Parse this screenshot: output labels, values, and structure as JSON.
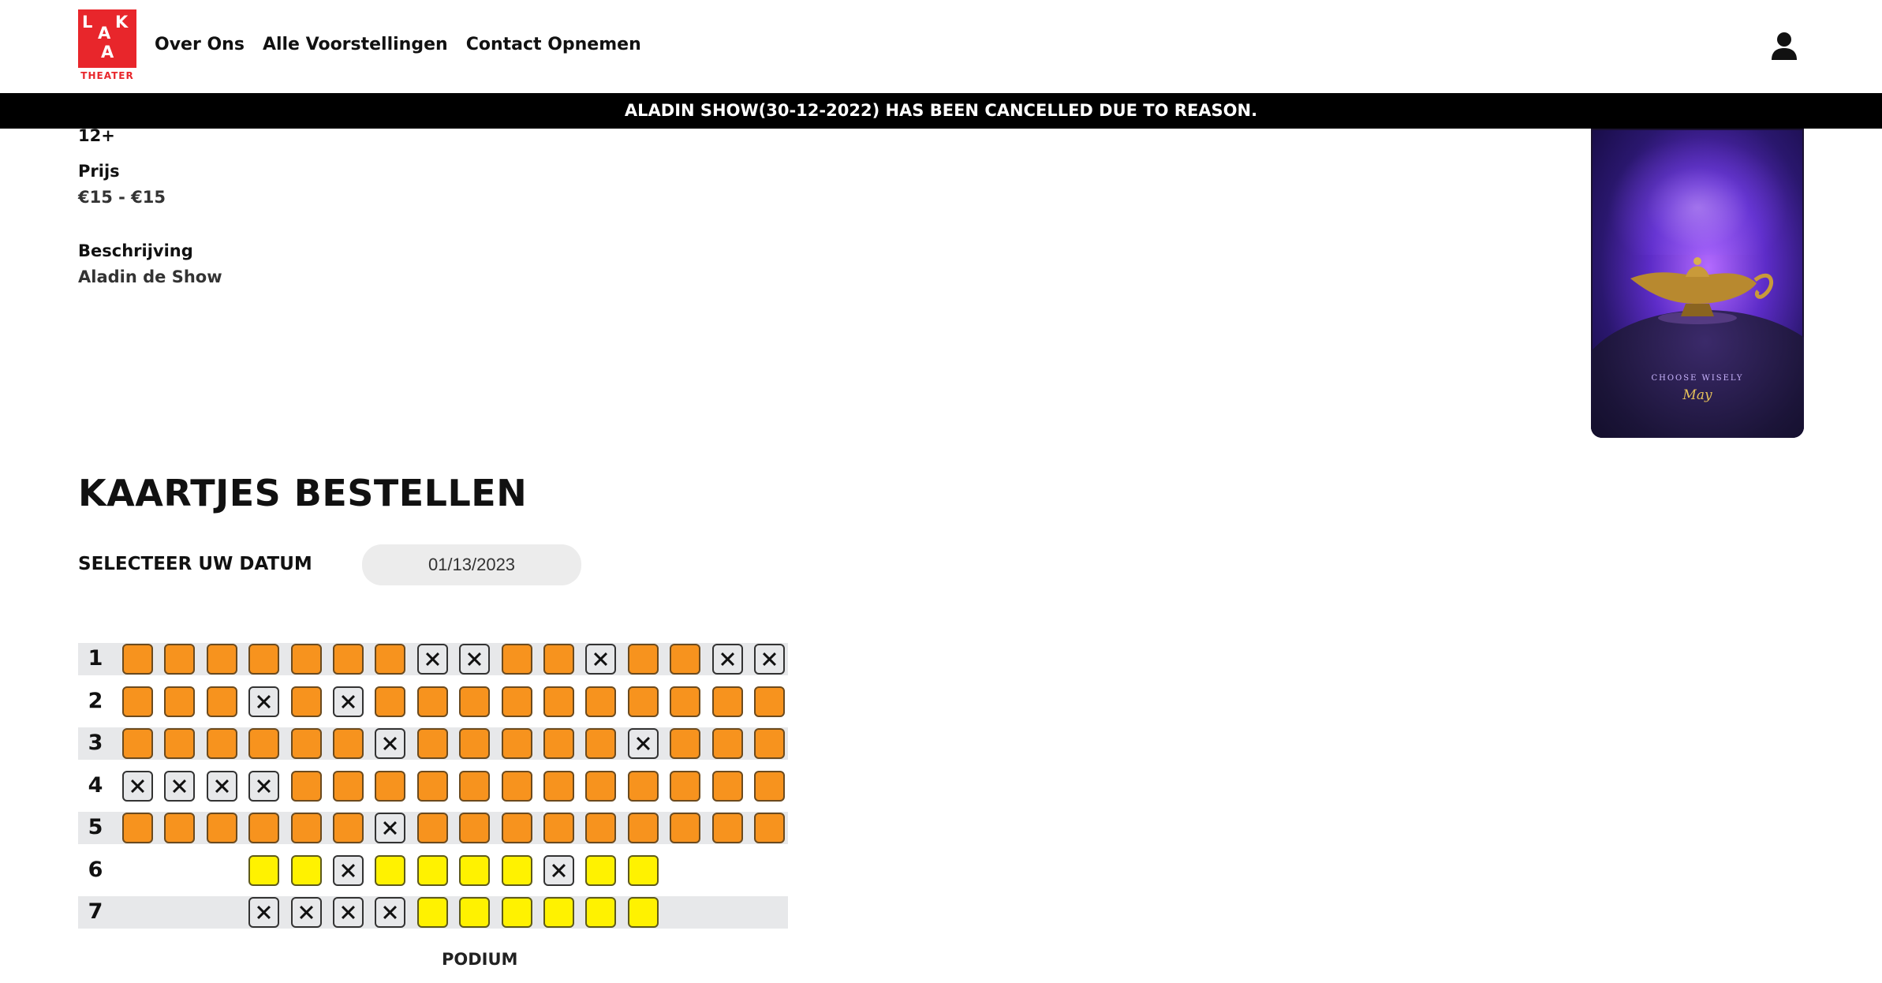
{
  "header": {
    "logo_letters": [
      "L",
      "A",
      "K",
      "A"
    ],
    "logo_sub": "THEATER",
    "nav": [
      "Over Ons",
      "Alle Voorstellingen",
      "Contact Opnemen"
    ],
    "user_icon": "user-icon"
  },
  "banner": {
    "text": "ALADIN SHOW(30-12-2022) HAS BEEN CANCELLED DUE TO REASON."
  },
  "details": {
    "age": "12+",
    "price_label": "Prijs",
    "price_value": "€15 - €15",
    "description_label": "Beschrijving",
    "description_value": "Aladin de Show"
  },
  "poster": {
    "tagline": "CHOOSE WISELY",
    "signature": "May"
  },
  "order": {
    "title": "KAARTJES BESTELLEN",
    "date_label": "SELECTEER UW DATUM",
    "date_value": "01/13/2023"
  },
  "seatmap": {
    "rows": [
      {
        "num": "1",
        "start": 0,
        "seats": [
          "o",
          "o",
          "o",
          "o",
          "o",
          "o",
          "o",
          "x",
          "x",
          "o",
          "o",
          "x",
          "o",
          "o",
          "x",
          "x"
        ]
      },
      {
        "num": "2",
        "start": 0,
        "seats": [
          "o",
          "o",
          "o",
          "x",
          "o",
          "x",
          "o",
          "o",
          "o",
          "o",
          "o",
          "o",
          "o",
          "o",
          "o",
          "o"
        ]
      },
      {
        "num": "3",
        "start": 0,
        "seats": [
          "o",
          "o",
          "o",
          "o",
          "o",
          "o",
          "x",
          "o",
          "o",
          "o",
          "o",
          "o",
          "x",
          "o",
          "o",
          "o"
        ]
      },
      {
        "num": "4",
        "start": 0,
        "seats": [
          "x",
          "x",
          "x",
          "x",
          "o",
          "o",
          "o",
          "o",
          "o",
          "o",
          "o",
          "o",
          "o",
          "o",
          "o",
          "o"
        ]
      },
      {
        "num": "5",
        "start": 0,
        "seats": [
          "o",
          "o",
          "o",
          "o",
          "o",
          "o",
          "x",
          "o",
          "o",
          "o",
          "o",
          "o",
          "o",
          "o",
          "o",
          "o"
        ]
      },
      {
        "num": "6",
        "start": 3,
        "seats": [
          "y",
          "y",
          "x",
          "y",
          "y",
          "y",
          "y",
          "x",
          "y",
          "y"
        ]
      },
      {
        "num": "7",
        "start": 3,
        "seats": [
          "x",
          "x",
          "x",
          "x",
          "y",
          "y",
          "y",
          "y",
          "y",
          "y"
        ]
      }
    ],
    "podium": "PODIUM",
    "colors": {
      "available_orange": "#f7931e",
      "available_yellow": "#fff200",
      "taken": "#e7e8ea"
    }
  }
}
